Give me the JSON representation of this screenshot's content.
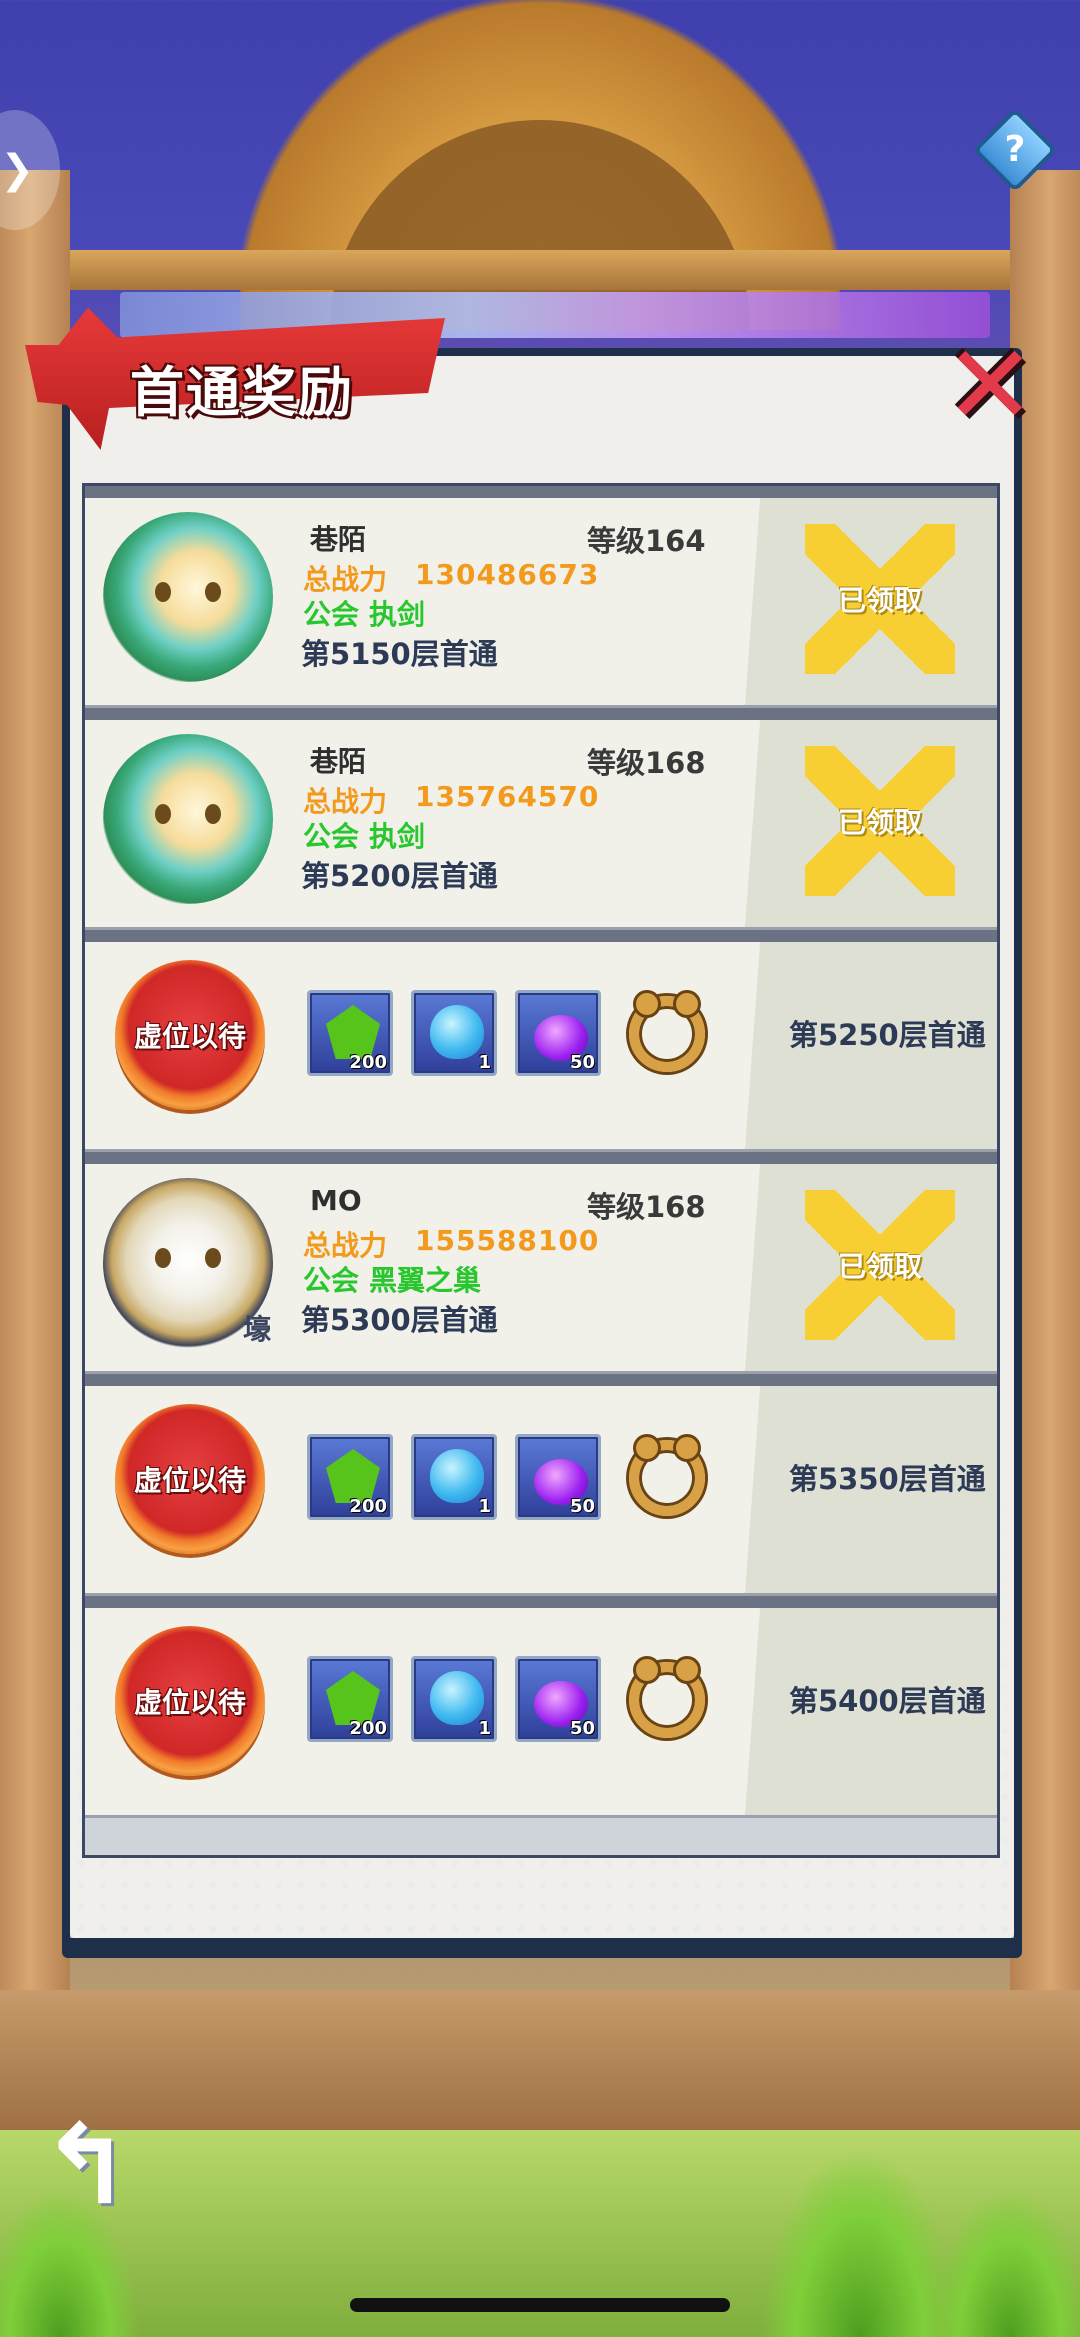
{
  "header": {
    "title": "首通奖励",
    "help_glyph": "?",
    "close_glyph": "✕",
    "back_glyph": "↰",
    "left_glyph": "❯"
  },
  "colors": {
    "power": "#f39a1c",
    "guild": "#27c72d",
    "floor_text": "#2c3a56",
    "claimed_badge": "#f8cf33",
    "vacant_button": "#d02727"
  },
  "rows": [
    {
      "type": "player",
      "avatar_icon": "green-dragon-girl-avatar",
      "name": "巷陌",
      "level": "等级164",
      "power_label": "总战力",
      "power": "130486673",
      "guild_label": "公会",
      "guild": "执剑",
      "floor": "第5150层首通",
      "status": "已领取"
    },
    {
      "type": "player",
      "avatar_icon": "green-dragon-girl-avatar",
      "name": "巷陌",
      "level": "等级168",
      "power_label": "总战力",
      "power": "135764570",
      "guild_label": "公会",
      "guild": "执剑",
      "floor": "第5200层首通",
      "status": "已领取"
    },
    {
      "type": "vacant",
      "button_label": "虚位以待",
      "items": [
        {
          "icon": "green-gem-icon",
          "qty": "200"
        },
        {
          "icon": "blue-egg-icon",
          "qty": "1"
        },
        {
          "icon": "purple-potion-icon",
          "qty": "50"
        },
        {
          "icon": "bear-ring-icon",
          "qty": ""
        }
      ],
      "floor": "第5250层首通"
    },
    {
      "type": "player",
      "avatar_icon": "white-hair-girl-avatar",
      "avatar_tag": "壕",
      "name": "MO",
      "level": "等级168",
      "power_label": "总战力",
      "power": "155588100",
      "guild_label": "公会",
      "guild": "黑翼之巢",
      "floor": "第5300层首通",
      "status": "已领取"
    },
    {
      "type": "vacant",
      "button_label": "虚位以待",
      "items": [
        {
          "icon": "green-gem-icon",
          "qty": "200"
        },
        {
          "icon": "blue-egg-icon",
          "qty": "1"
        },
        {
          "icon": "purple-potion-icon",
          "qty": "50"
        },
        {
          "icon": "bear-ring-icon",
          "qty": ""
        }
      ],
      "floor": "第5350层首通"
    },
    {
      "type": "vacant",
      "button_label": "虚位以待",
      "items": [
        {
          "icon": "green-gem-icon",
          "qty": "200"
        },
        {
          "icon": "blue-egg-icon",
          "qty": "1"
        },
        {
          "icon": "purple-potion-icon",
          "qty": "50"
        },
        {
          "icon": "bear-ring-icon",
          "qty": ""
        }
      ],
      "floor": "第5400层首通"
    }
  ]
}
